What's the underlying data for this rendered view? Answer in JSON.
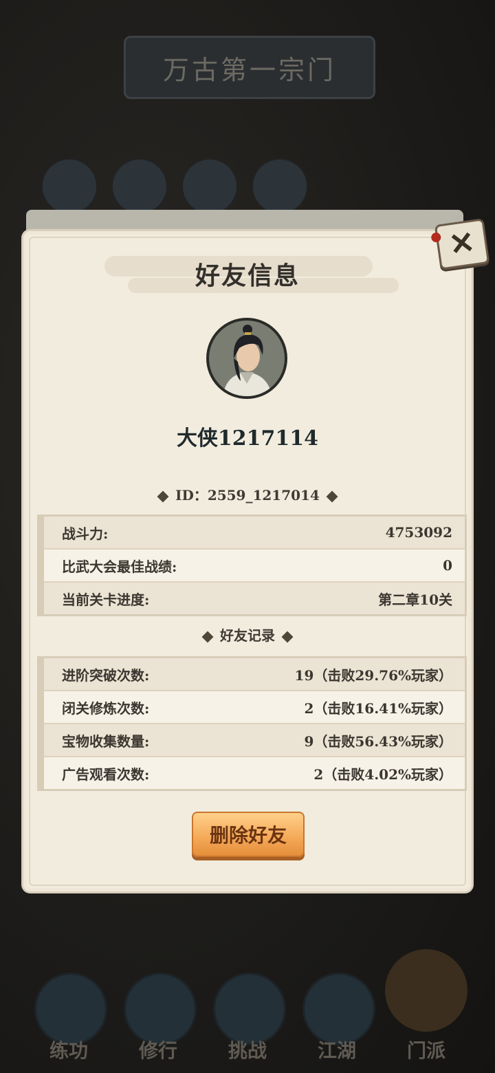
{
  "background": {
    "game_title": "万古第一宗门",
    "nav": [
      "练功",
      "修行",
      "挑战",
      "江湖",
      "门派"
    ]
  },
  "modal": {
    "title": "好友信息",
    "player_name": "大侠1217114",
    "id_label": "ID：",
    "id_value": "2559_1217014",
    "stats": [
      {
        "label": "战斗力:",
        "value": "4753092"
      },
      {
        "label": "比武大会最佳战绩:",
        "value": "0"
      },
      {
        "label": "当前关卡进度:",
        "value": "第二章10关"
      }
    ],
    "records_title": "好友记录",
    "records": [
      {
        "label": "进阶突破次数:",
        "value": "19（击败29.76%玩家）"
      },
      {
        "label": "闭关修炼次数:",
        "value": "2（击败16.41%玩家）"
      },
      {
        "label": "宝物收集数量:",
        "value": "9（击败56.43%玩家）"
      },
      {
        "label": "广告观看次数:",
        "value": "2（击败4.02%玩家）"
      }
    ],
    "delete_button": "删除好友",
    "close_icon": "close-icon"
  }
}
